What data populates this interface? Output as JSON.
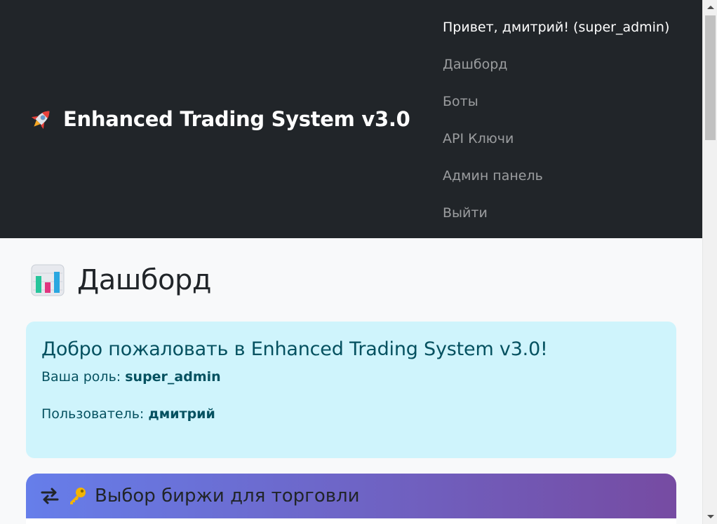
{
  "navbar": {
    "brand": "Enhanced Trading System v3.0",
    "greeting": "Привет, дмитрий! (super_admin)",
    "items": [
      {
        "label": "Дашборд"
      },
      {
        "label": "Боты"
      },
      {
        "label": "API Ключи"
      },
      {
        "label": "Админ панель"
      },
      {
        "label": "Выйти"
      }
    ]
  },
  "main": {
    "title": "Дашборд",
    "welcome": {
      "heading": "Добро пожаловать в Enhanced Trading System v3.0!",
      "role_label": "Ваша роль:",
      "role_value": "super_admin",
      "user_label": "Пользователь:",
      "user_value": "дмитрий"
    },
    "exchange_card": {
      "header": "Выбор биржи для торговли"
    }
  },
  "colors": {
    "navbar_bg": "#212529",
    "alert_bg": "#cff4fc",
    "alert_text": "#055160",
    "gradient_start": "#667eea",
    "gradient_end": "#764ba2"
  },
  "icons": {
    "brand": "rocket-icon",
    "title": "bar-chart-icon",
    "card_header": [
      "swap-arrows-icon",
      "key-icon"
    ]
  }
}
